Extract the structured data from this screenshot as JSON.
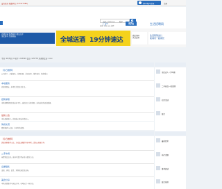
{
  "topbar": {
    "tip": "设为首页  收藏本站 (777977386)",
    "login_label": "用QQ帐号登录",
    "register_label": "注册"
  },
  "header": {
    "search_placeholder": "请输入搜索内容",
    "search_type": "帖子",
    "hot_text": "热搜: 活动 交友 招聘"
  },
  "nav": {
    "items": [
      {
        "label": "门户",
        "active": false
      },
      {
        "label": "论坛",
        "active": true
      },
      {
        "label": "生活招聘网",
        "active": false
      }
    ]
  },
  "banner": {
    "left_ad_lines": [
      "品牌全城 免费推荐  精品点评",
      "全民参与 互动热线"
    ],
    "main_ad_left": "全城送酒",
    "main_ad_right": "19分钟速达",
    "qr_lines": [
      "微信扫码",
      "关注送券"
    ],
    "right_ad_lines": [
      "生活就到这儿",
      "和城市一起成长"
    ]
  },
  "stats": {
    "text": "今日: 26   昨日: 0   帖子: 223329   会员: 125778   欢迎新会员: xxxx"
  },
  "posts": [
    {
      "title": "【今日推荐】",
      "desc": "公司简介、开始报名、往期回顾、活动日程、推荐嘉宾、精彩看点",
      "red": false
    },
    {
      "title": "本地服务",
      "desc": "欢迎新朋友，本地生活信息全汇总。",
      "red": false
    },
    {
      "title": "招聘求职",
      "desc": "本地招聘求职信息发布平台，诚信招工方便求职，发布前请先阅读版规。",
      "red": false
    },
    {
      "title": "最新公告",
      "desc": "本站招募版主，欢迎热心网友申请加入。",
      "red": true
    },
    {
      "title": "情感交流",
      "desc": "情感倾诉与交流，分享你的故事。",
      "red": false
    },
    {
      "title": "【今日推荐】",
      "desc": "优质商家推荐入驻，互动交流精彩内容不断，活动火热进行中。",
      "red": true
    },
    {
      "title": "二手市场",
      "desc": "闲置物品交易，发布时请注明价格与联系方式。",
      "red": false
    },
    {
      "title": "房屋租售",
      "desc": "出租、求租、出售、求购房屋信息发布。",
      "red": false
    },
    {
      "title": "美食分享",
      "desc": "本地美食推荐与探店分享，吃喝玩乐一网打尽。",
      "red": false
    }
  ],
  "sidebar": {
    "items": [
      "全民达人（早1期）",
      "二手商品一批清理",
      "社区活动",
      "版主",
      "最新回复",
      "热门话题",
      "推荐阅读",
      "版主推荐"
    ]
  }
}
